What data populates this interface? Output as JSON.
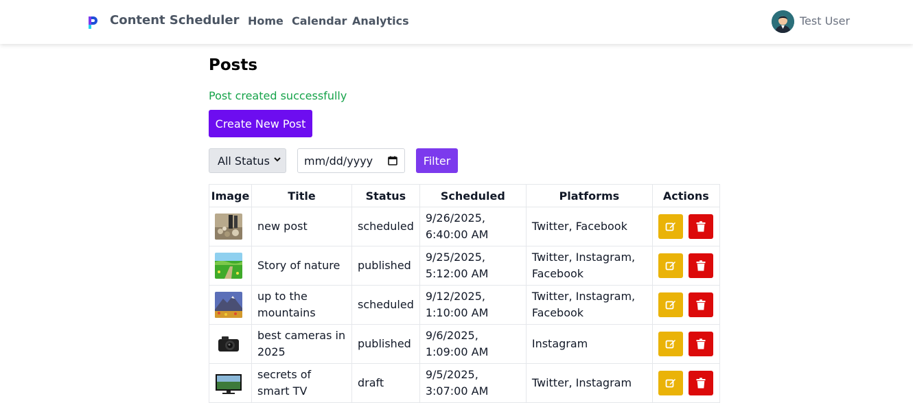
{
  "header": {
    "brand": "Content Scheduler",
    "nav": [
      "Home",
      "Calendar",
      "Analytics"
    ],
    "user_name": "Test User"
  },
  "main": {
    "title": "Posts",
    "success_message": "Post created successfully",
    "create_label": "Create New Post",
    "filters": {
      "status_value": "All Status",
      "date_placeholder": "mm/dd/yyyy",
      "filter_label": "Filter"
    },
    "table": {
      "columns": [
        "Image",
        "Title",
        "Status",
        "Scheduled",
        "Platforms",
        "Actions"
      ],
      "rows": [
        {
          "title": "new post",
          "status": "scheduled",
          "scheduled": "9/26/2025, 6:40:00 AM",
          "platforms": "Twitter, Facebook",
          "thumb": "street"
        },
        {
          "title": "Story of nature",
          "status": "published",
          "scheduled": "9/25/2025, 5:12:00 AM",
          "platforms": "Twitter, Instagram, Facebook",
          "thumb": "meadow"
        },
        {
          "title": "up to the mountains",
          "status": "scheduled",
          "scheduled": "9/12/2025, 1:10:00 AM",
          "platforms": "Twitter, Instagram, Facebook",
          "thumb": "mountain"
        },
        {
          "title": "best cameras in 2025",
          "status": "published",
          "scheduled": "9/6/2025, 1:09:00 AM",
          "platforms": "Instagram",
          "thumb": "camera"
        },
        {
          "title": "secrets of smart TV",
          "status": "draft",
          "scheduled": "9/5/2025, 3:07:00 AM",
          "platforms": "Twitter, Instagram",
          "thumb": "tv"
        }
      ]
    }
  },
  "colors": {
    "primary": "#6d0df0",
    "filter": "#7c3aed",
    "success": "#16a34a",
    "edit": "#eab308",
    "delete": "#dc0a0a"
  },
  "icons": {
    "edit": "pencil-square-icon",
    "delete": "trash-icon"
  }
}
